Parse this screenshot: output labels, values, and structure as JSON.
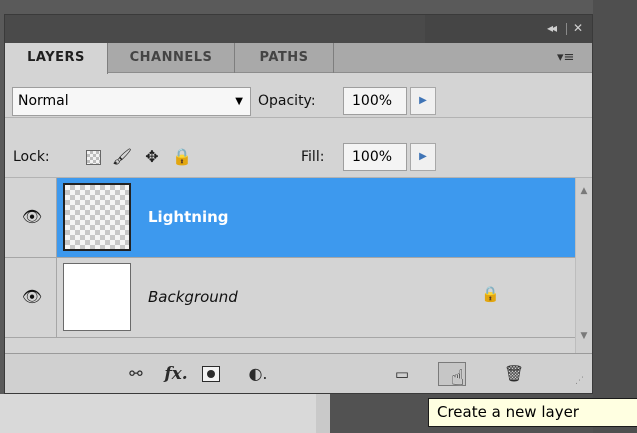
{
  "panel": {
    "titlebar": {
      "collapse_icon": "collapse-arrows-icon",
      "close_icon": "close-icon"
    },
    "tabs": [
      {
        "label": "LAYERS",
        "active": true
      },
      {
        "label": "CHANNELS",
        "active": false
      },
      {
        "label": "PATHS",
        "active": false
      }
    ],
    "panel_menu_icon": "panel-menu-icon"
  },
  "options": {
    "blend_mode": "Normal",
    "opacity_label": "Opacity:",
    "opacity_value": "100%",
    "lock_label": "Lock:",
    "fill_label": "Fill:",
    "fill_value": "100%"
  },
  "layers": [
    {
      "name": "Lightning",
      "visible": true,
      "selected": true,
      "thumbnail": "transparent"
    },
    {
      "name": "Background",
      "visible": true,
      "selected": false,
      "locked": true,
      "thumbnail": "white"
    }
  ],
  "toolbar": {
    "icons": [
      "link-layers-icon",
      "fx-icon",
      "layer-mask-icon",
      "adjustment-layer-icon",
      "group-folder-icon",
      "new-layer-icon",
      "trash-icon"
    ],
    "fx_label": "fx"
  },
  "tooltip": {
    "text": "Create a new layer"
  },
  "colors": {
    "selection": "#3d99ee",
    "panel_bg": "#d4d4d4",
    "tooltip_bg": "#ffffe1"
  }
}
